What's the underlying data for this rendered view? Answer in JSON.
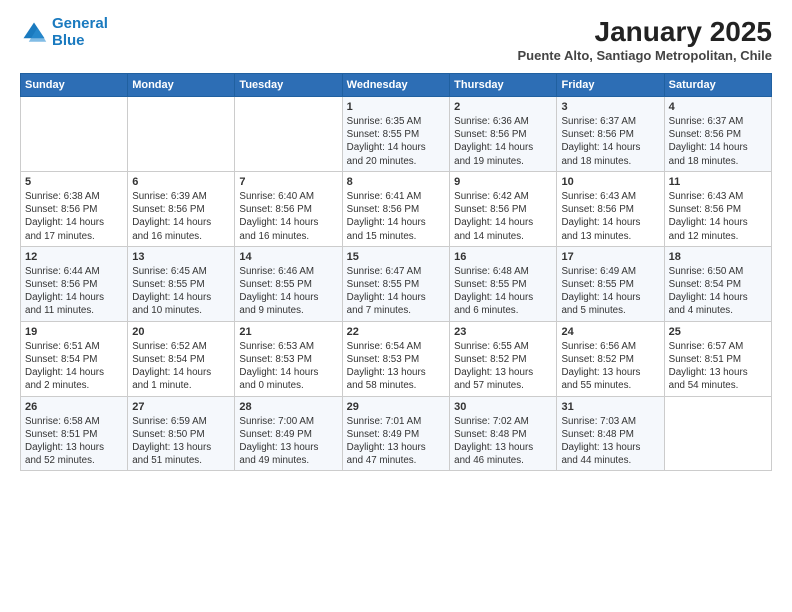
{
  "logo": {
    "line1": "General",
    "line2": "Blue"
  },
  "title": "January 2025",
  "subtitle": "Puente Alto, Santiago Metropolitan, Chile",
  "days_of_week": [
    "Sunday",
    "Monday",
    "Tuesday",
    "Wednesday",
    "Thursday",
    "Friday",
    "Saturday"
  ],
  "weeks": [
    [
      {
        "day": "",
        "info": ""
      },
      {
        "day": "",
        "info": ""
      },
      {
        "day": "",
        "info": ""
      },
      {
        "day": "1",
        "info": "Sunrise: 6:35 AM\nSunset: 8:55 PM\nDaylight: 14 hours\nand 20 minutes."
      },
      {
        "day": "2",
        "info": "Sunrise: 6:36 AM\nSunset: 8:56 PM\nDaylight: 14 hours\nand 19 minutes."
      },
      {
        "day": "3",
        "info": "Sunrise: 6:37 AM\nSunset: 8:56 PM\nDaylight: 14 hours\nand 18 minutes."
      },
      {
        "day": "4",
        "info": "Sunrise: 6:37 AM\nSunset: 8:56 PM\nDaylight: 14 hours\nand 18 minutes."
      }
    ],
    [
      {
        "day": "5",
        "info": "Sunrise: 6:38 AM\nSunset: 8:56 PM\nDaylight: 14 hours\nand 17 minutes."
      },
      {
        "day": "6",
        "info": "Sunrise: 6:39 AM\nSunset: 8:56 PM\nDaylight: 14 hours\nand 16 minutes."
      },
      {
        "day": "7",
        "info": "Sunrise: 6:40 AM\nSunset: 8:56 PM\nDaylight: 14 hours\nand 16 minutes."
      },
      {
        "day": "8",
        "info": "Sunrise: 6:41 AM\nSunset: 8:56 PM\nDaylight: 14 hours\nand 15 minutes."
      },
      {
        "day": "9",
        "info": "Sunrise: 6:42 AM\nSunset: 8:56 PM\nDaylight: 14 hours\nand 14 minutes."
      },
      {
        "day": "10",
        "info": "Sunrise: 6:43 AM\nSunset: 8:56 PM\nDaylight: 14 hours\nand 13 minutes."
      },
      {
        "day": "11",
        "info": "Sunrise: 6:43 AM\nSunset: 8:56 PM\nDaylight: 14 hours\nand 12 minutes."
      }
    ],
    [
      {
        "day": "12",
        "info": "Sunrise: 6:44 AM\nSunset: 8:56 PM\nDaylight: 14 hours\nand 11 minutes."
      },
      {
        "day": "13",
        "info": "Sunrise: 6:45 AM\nSunset: 8:55 PM\nDaylight: 14 hours\nand 10 minutes."
      },
      {
        "day": "14",
        "info": "Sunrise: 6:46 AM\nSunset: 8:55 PM\nDaylight: 14 hours\nand 9 minutes."
      },
      {
        "day": "15",
        "info": "Sunrise: 6:47 AM\nSunset: 8:55 PM\nDaylight: 14 hours\nand 7 minutes."
      },
      {
        "day": "16",
        "info": "Sunrise: 6:48 AM\nSunset: 8:55 PM\nDaylight: 14 hours\nand 6 minutes."
      },
      {
        "day": "17",
        "info": "Sunrise: 6:49 AM\nSunset: 8:55 PM\nDaylight: 14 hours\nand 5 minutes."
      },
      {
        "day": "18",
        "info": "Sunrise: 6:50 AM\nSunset: 8:54 PM\nDaylight: 14 hours\nand 4 minutes."
      }
    ],
    [
      {
        "day": "19",
        "info": "Sunrise: 6:51 AM\nSunset: 8:54 PM\nDaylight: 14 hours\nand 2 minutes."
      },
      {
        "day": "20",
        "info": "Sunrise: 6:52 AM\nSunset: 8:54 PM\nDaylight: 14 hours\nand 1 minute."
      },
      {
        "day": "21",
        "info": "Sunrise: 6:53 AM\nSunset: 8:53 PM\nDaylight: 14 hours\nand 0 minutes."
      },
      {
        "day": "22",
        "info": "Sunrise: 6:54 AM\nSunset: 8:53 PM\nDaylight: 13 hours\nand 58 minutes."
      },
      {
        "day": "23",
        "info": "Sunrise: 6:55 AM\nSunset: 8:52 PM\nDaylight: 13 hours\nand 57 minutes."
      },
      {
        "day": "24",
        "info": "Sunrise: 6:56 AM\nSunset: 8:52 PM\nDaylight: 13 hours\nand 55 minutes."
      },
      {
        "day": "25",
        "info": "Sunrise: 6:57 AM\nSunset: 8:51 PM\nDaylight: 13 hours\nand 54 minutes."
      }
    ],
    [
      {
        "day": "26",
        "info": "Sunrise: 6:58 AM\nSunset: 8:51 PM\nDaylight: 13 hours\nand 52 minutes."
      },
      {
        "day": "27",
        "info": "Sunrise: 6:59 AM\nSunset: 8:50 PM\nDaylight: 13 hours\nand 51 minutes."
      },
      {
        "day": "28",
        "info": "Sunrise: 7:00 AM\nSunset: 8:49 PM\nDaylight: 13 hours\nand 49 minutes."
      },
      {
        "day": "29",
        "info": "Sunrise: 7:01 AM\nSunset: 8:49 PM\nDaylight: 13 hours\nand 47 minutes."
      },
      {
        "day": "30",
        "info": "Sunrise: 7:02 AM\nSunset: 8:48 PM\nDaylight: 13 hours\nand 46 minutes."
      },
      {
        "day": "31",
        "info": "Sunrise: 7:03 AM\nSunset: 8:48 PM\nDaylight: 13 hours\nand 44 minutes."
      },
      {
        "day": "",
        "info": ""
      }
    ]
  ]
}
